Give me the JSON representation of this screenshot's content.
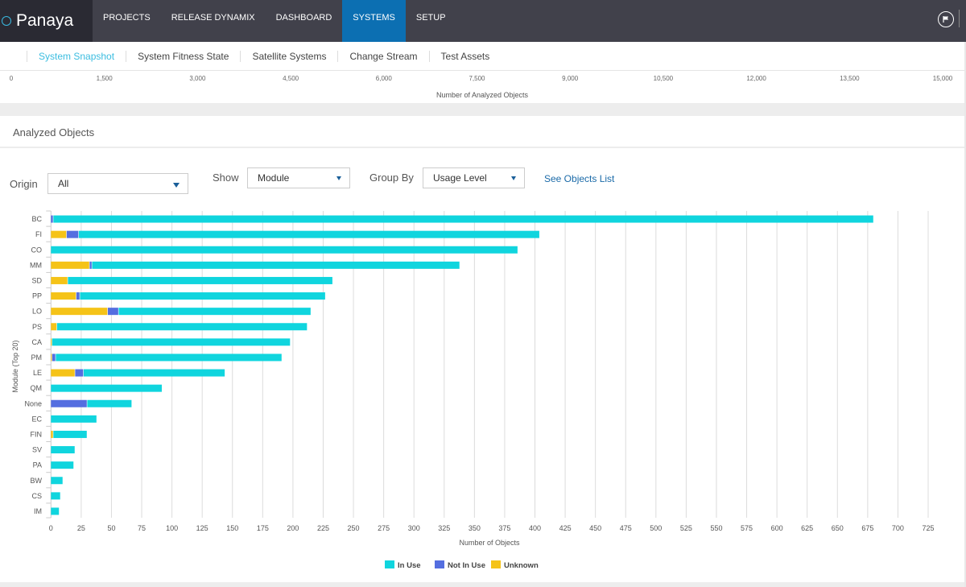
{
  "app": {
    "logo_text": "Panaya"
  },
  "nav": {
    "items": [
      {
        "label": "PROJECTS",
        "active": false
      },
      {
        "label": "RELEASE DYNAMIX",
        "active": false
      },
      {
        "label": "DASHBOARD",
        "active": false
      },
      {
        "label": "SYSTEMS",
        "active": true
      },
      {
        "label": "SETUP",
        "active": false
      }
    ],
    "flag_icon": "flag-icon"
  },
  "subnav": {
    "items": [
      {
        "label": "System Snapshot",
        "active": true
      },
      {
        "label": "System Fitness State",
        "active": false
      },
      {
        "label": "Satellite Systems",
        "active": false
      },
      {
        "label": "Change Stream",
        "active": false
      },
      {
        "label": "Test Assets",
        "active": false
      }
    ]
  },
  "top_axis": {
    "ticks": [
      "0",
      "1,500",
      "3,000",
      "4,500",
      "6,000",
      "7,500",
      "9,000",
      "10,500",
      "12,000",
      "13,500",
      "15,000"
    ],
    "title": "Number of Analyzed Objects"
  },
  "section": {
    "title": "Analyzed Objects"
  },
  "controls": {
    "origin_label": "Origin",
    "origin_value": "All",
    "show_label": "Show",
    "show_value": "Module",
    "group_by_label": "Group By",
    "group_by_value": "Usage Level",
    "see_objects_link": "See Objects List"
  },
  "chart_data": {
    "type": "bar",
    "orientation": "horizontal",
    "stacked": true,
    "title": "",
    "xlabel": "Number of Objects",
    "ylabel": "Module (Top 20)",
    "xlim": [
      0,
      725
    ],
    "xticks": [
      0,
      25,
      50,
      75,
      100,
      125,
      150,
      175,
      200,
      225,
      250,
      275,
      300,
      325,
      350,
      375,
      400,
      425,
      450,
      475,
      500,
      525,
      550,
      575,
      600,
      625,
      650,
      675,
      700,
      725
    ],
    "grid": true,
    "legend": "bottom-center",
    "categories": [
      "BC",
      "FI",
      "CO",
      "MM",
      "SD",
      "PP",
      "LO",
      "PS",
      "CA",
      "PM",
      "LE",
      "QM",
      "None",
      "EC",
      "FIN",
      "SV",
      "PA",
      "BW",
      "CS",
      "IM"
    ],
    "series": [
      {
        "name": "Unknown",
        "color": "#f5c318",
        "values": [
          0,
          13,
          0,
          32,
          14,
          21,
          47,
          5,
          1,
          1,
          20,
          0,
          0,
          0,
          2,
          0,
          0,
          0,
          0,
          0
        ]
      },
      {
        "name": "Not In Use",
        "color": "#546ee0",
        "values": [
          2,
          10,
          0,
          2,
          0,
          3,
          9,
          0,
          0,
          3,
          7,
          0,
          30,
          0,
          0,
          0,
          0,
          0,
          0,
          0
        ]
      },
      {
        "name": "In Use",
        "color": "#10d5de",
        "values": [
          678,
          381,
          386,
          304,
          219,
          203,
          159,
          207,
          197,
          187,
          117,
          92,
          37,
          38,
          28,
          20,
          19,
          10,
          8,
          7
        ]
      }
    ],
    "legend_order": [
      "In Use",
      "Not In Use",
      "Unknown"
    ]
  }
}
